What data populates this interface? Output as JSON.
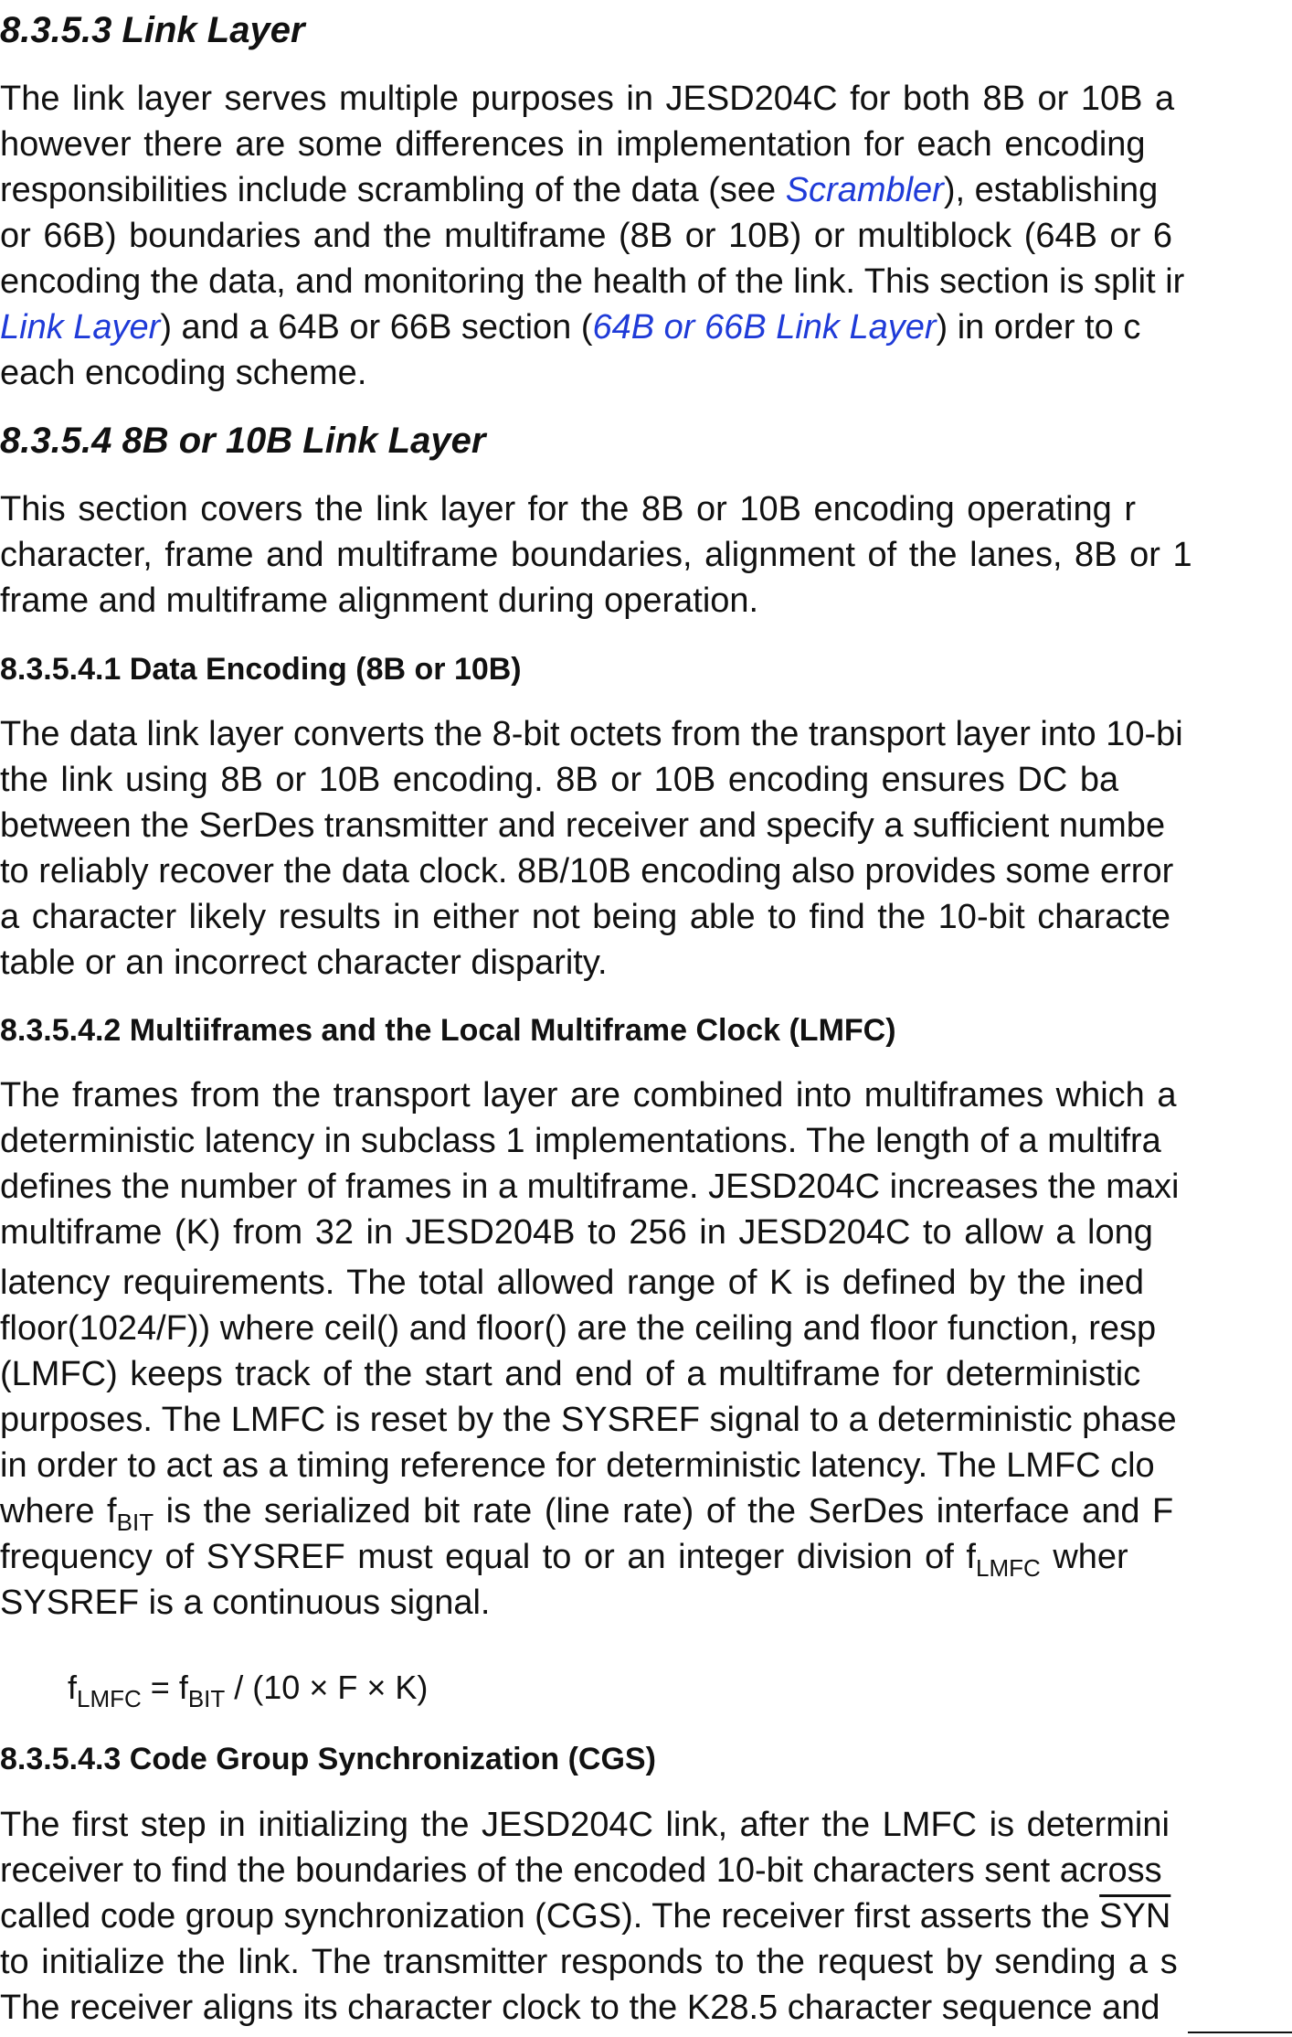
{
  "sections": [
    {
      "number": "8.3.5.3",
      "title": "Link Layer"
    },
    {
      "number": "8.3.5.4",
      "title": "8B or 10B Link Layer"
    }
  ],
  "subsections": [
    {
      "number": "8.3.5.4.1",
      "title": "Data Encoding (8B or 10B)"
    },
    {
      "number": "8.3.5.4.2",
      "title": "Multiiframes and the Local Multiframe Clock (LMFC)"
    },
    {
      "number": "8.3.5.4.3",
      "title": "Code Group Synchronization (CGS)"
    }
  ],
  "link_layer_paragraph": {
    "l1": "The link layer serves multiple purposes in JESD204C for both 8B or 10B a",
    "l2": "however there are some differences in implementation for each encoding",
    "l3a": "responsibilities include scrambling of the data (see ",
    "l3link": "Scrambler",
    "l3b": "), establishing",
    "l4": "or 66B) boundaries and the multiframe (8B or 10B) or multiblock (64B or 6",
    "l5": "encoding the data, and monitoring the health of the link. This section is split ir",
    "l6link1": "Link Layer",
    "l6mid": ") and a 64B or 66B section (",
    "l6link2": "64B or 66B Link Layer",
    "l6b": ") in order to c",
    "l7": "each encoding scheme."
  },
  "eight_ten_paragraph": {
    "l1": "This section covers the link layer for the 8B or 10B encoding operating r",
    "l2": "character, frame and multiframe boundaries, alignment of the lanes, 8B or 1",
    "l3": "frame and multiframe alignment during operation."
  },
  "data_encoding_paragraph": {
    "l1": "The data link layer converts the 8-bit octets from the transport layer into 10-bi",
    "l2": "the link using 8B or 10B encoding. 8B or 10B encoding ensures DC ba",
    "l3": "between the SerDes transmitter and receiver and specify a sufficient numbe",
    "l4": "to reliably recover the data clock. 8B/10B encoding also provides some error",
    "l5": "a character likely results in either not being able to find the 10-bit characte",
    "l6": "table or an incorrect character disparity."
  },
  "lmfc_paragraph": {
    "l1": "The frames from the transport layer are combined into multiframes which a",
    "l2": "deterministic latency in subclass 1 implementations. The length of a multifra",
    "l3": "defines the number of frames in a multiframe. JESD204C increases the maxi",
    "l4": "multiframe (K) from 32 in JESD204B to 256 in JESD204C to allow a long",
    "l5": "latency requirements. The total allowed range of K is defined by the ined",
    "l6": "floor(1024/F)) where ceil() and floor() are the ceiling and floor function, resp",
    "l7": "(LMFC) keeps track of the start and end of a multiframe for deterministic",
    "l8": "purposes. The LMFC is reset by the SYSREF signal to a deterministic phase",
    "l9": "in order to act as a timing reference for deterministic latency. The LMFC clo",
    "l10a": "where f",
    "l10sub": "BIT",
    "l10b": " is the serialized bit rate (line rate) of the SerDes interface and F",
    "l11a": "frequency of SYSREF must equal to or an integer division of f",
    "l11sub": "LMFC",
    "l11b": " wher",
    "l12": "SYSREF is a continuous signal."
  },
  "equation": {
    "f": "f",
    "lhs_sub": "LMFC",
    "eq": " = f",
    "rhs_sub": "BIT",
    "rest": " / (10 × F × K)"
  },
  "cgs_paragraph": {
    "l1": "The first step in initializing the JESD204C link, after the LMFC is determini",
    "l2": "receiver to find the boundaries of the encoded 10-bit characters sent across",
    "l3a": "called code group synchronization (CGS). The receiver first asserts the ",
    "l3over": "SYN",
    "l4": "to initialize the link. The transmitter responds to the request by sending a s",
    "l5": "The receiver aligns its character clock to the K28.5 character sequence and"
  }
}
